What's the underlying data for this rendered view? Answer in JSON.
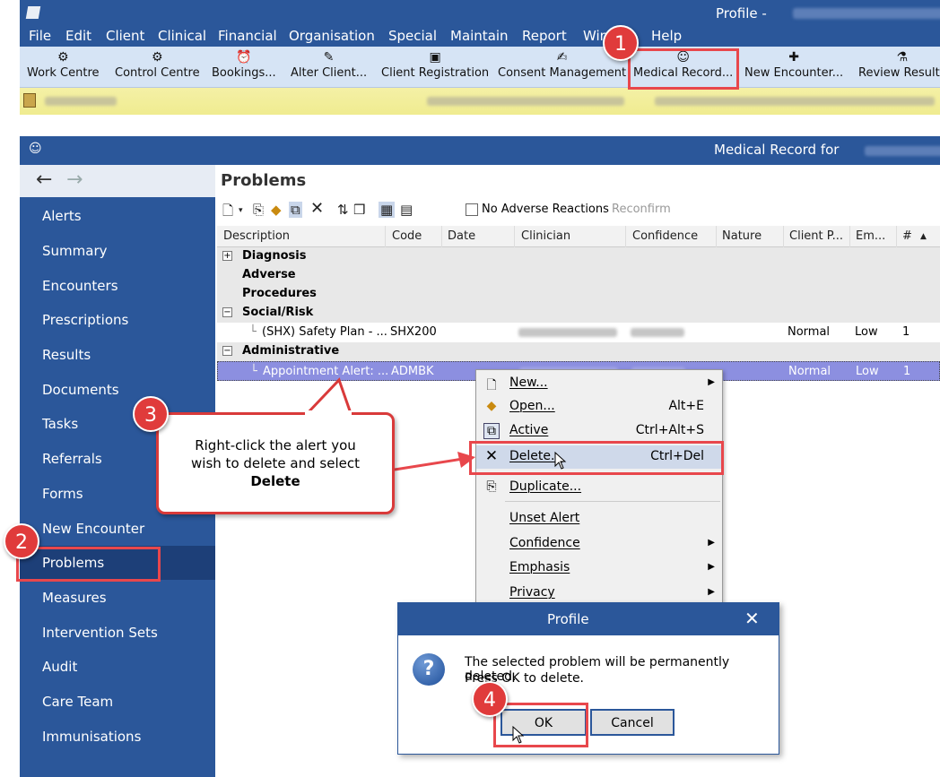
{
  "window": {
    "title": "Profile -"
  },
  "menu": [
    "File",
    "Edit",
    "Client",
    "Clinical",
    "Financial",
    "Organisation",
    "Special",
    "Maintain",
    "Report",
    "Win",
    "Help"
  ],
  "toolbar": [
    {
      "label": "Work Centre",
      "icon": "work-centre-icon"
    },
    {
      "label": "Control Centre",
      "icon": "control-centre-icon"
    },
    {
      "label": "Bookings...",
      "icon": "bookings-icon"
    },
    {
      "label": "Alter Client...",
      "icon": "alter-client-icon"
    },
    {
      "label": "Client Registration",
      "icon": "client-registration-icon"
    },
    {
      "label": "Consent Management",
      "icon": "consent-icon"
    },
    {
      "label": "Medical Record...",
      "icon": "medical-record-icon"
    },
    {
      "label": "New Encounter...",
      "icon": "new-encounter-icon"
    },
    {
      "label": "Review Results",
      "icon": "review-results-icon"
    }
  ],
  "record_header": {
    "title": "Medical Record for"
  },
  "sidebar": [
    "Alerts",
    "Summary",
    "Encounters",
    "Prescriptions",
    "Results",
    "Documents",
    "Tasks",
    "Referrals",
    "Forms",
    "New Encounter",
    "Problems",
    "Measures",
    "Intervention Sets",
    "Audit",
    "Care Team",
    "Immunisations"
  ],
  "problems": {
    "title": "Problems",
    "no_adverse": "No Adverse Reactions",
    "reconfirm": "Reconfirm",
    "columns": [
      "Description",
      "Code",
      "Date",
      "Clinician",
      "Confidence",
      "Nature",
      "Client P...",
      "Em...",
      "#"
    ],
    "groups": {
      "diagnosis": "Diagnosis",
      "adverse": "Adverse",
      "procedures": "Procedures",
      "social": "Social/Risk",
      "admin": "Administrative"
    },
    "row1": {
      "description": "(SHX) Safety Plan - ...",
      "code": "SHX200",
      "client_p": "Normal",
      "em": "Low",
      "num": "1"
    },
    "row2": {
      "description": "Appointment Alert: ...",
      "code": "ADMBK",
      "client_p": "Normal",
      "em": "Low",
      "num": "1"
    }
  },
  "context_menu": [
    {
      "label": "New...",
      "shortcut": "",
      "submenu": true
    },
    {
      "label": "Open...",
      "shortcut": "Alt+E",
      "submenu": false
    },
    {
      "label": "Active",
      "shortcut": "Ctrl+Alt+S",
      "submenu": false
    },
    {
      "label": "Delete...",
      "shortcut": "Ctrl+Del",
      "submenu": false
    },
    {
      "label": "Duplicate...",
      "shortcut": "",
      "submenu": false
    },
    {
      "label": "Unset Alert",
      "shortcut": "",
      "submenu": false
    },
    {
      "label": "Confidence",
      "shortcut": "",
      "submenu": true
    },
    {
      "label": "Emphasis",
      "shortcut": "",
      "submenu": true
    },
    {
      "label": "Privacy",
      "shortcut": "",
      "submenu": true
    }
  ],
  "dialog": {
    "title": "Profile",
    "line1": "The selected problem will be permanently deleted.",
    "line2": "Press OK to delete.",
    "ok": "OK",
    "cancel": "Cancel"
  },
  "callout": {
    "text1": "Right-click the alert you",
    "text2": "wish to delete and select",
    "text3": "Delete"
  },
  "steps": [
    "1",
    "2",
    "3",
    "4"
  ],
  "colors": {
    "brand": "#2b579a",
    "banner": "#f0ec90",
    "annotation": "#e03b3b",
    "selection": "#8c8fe0"
  }
}
